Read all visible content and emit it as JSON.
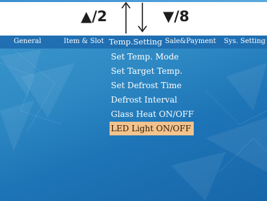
{
  "hints": {
    "up_label": "▲/2",
    "down_label": "▼/8"
  },
  "tabs": [
    {
      "label": "General"
    },
    {
      "label": "Item & Slot"
    },
    {
      "label": "Temp.Setting"
    },
    {
      "label": "Sale&Payment"
    },
    {
      "label": "Sys. Setting"
    }
  ],
  "active_tab": "Temp.Setting",
  "menu": {
    "items": [
      {
        "label": "Set Temp. Mode"
      },
      {
        "label": "Set Target Temp."
      },
      {
        "label": "Set Defrost Time"
      },
      {
        "label": "Defrost Interval"
      },
      {
        "label": "Glass Heat ON/OFF"
      },
      {
        "label": "LED Light ON/OFF"
      }
    ],
    "selected": "LED Light ON/OFF"
  },
  "colors": {
    "screen_background": "#2f8ac4",
    "tab_bar": "#1f6fb2",
    "selection_highlight": "#f4c38d"
  },
  "icons": [
    "arrow-up-icon",
    "arrow-down-icon"
  ]
}
